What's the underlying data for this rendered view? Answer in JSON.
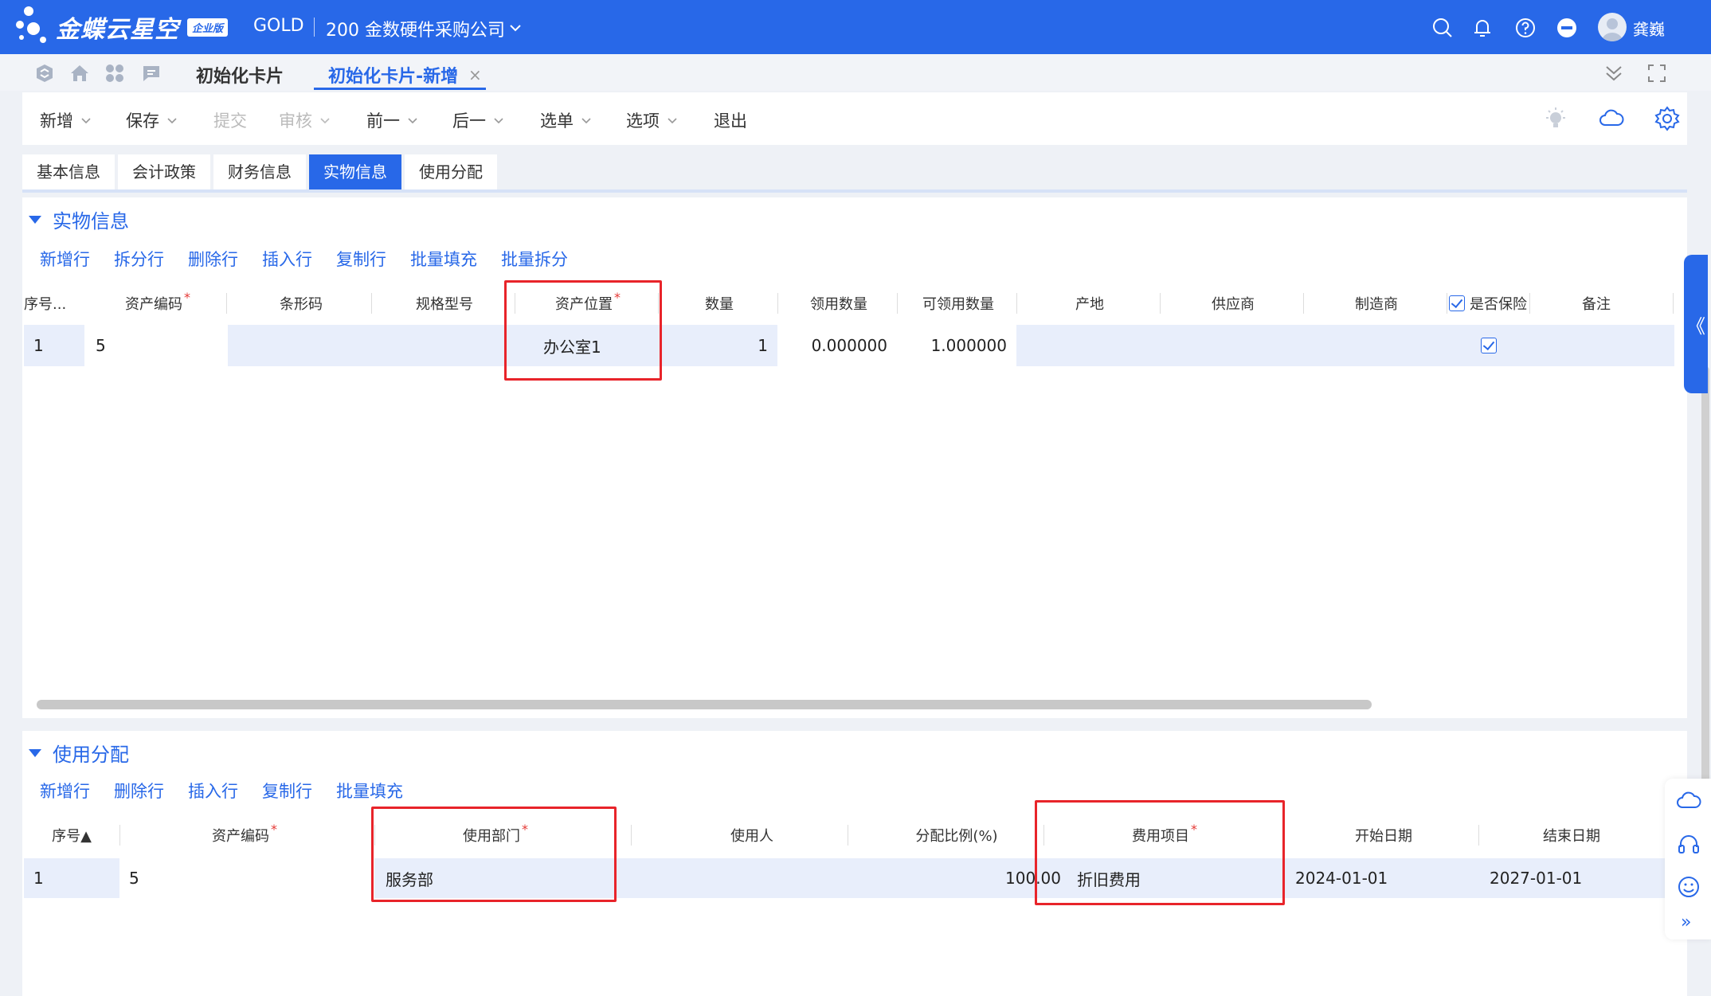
{
  "header": {
    "brand": "金蝶云星空",
    "edition_badge": "企业版",
    "gold": "GOLD",
    "org": "200 金数硬件采购公司",
    "user": "龚巍",
    "brand_color": "#2868e8"
  },
  "page_tabs": [
    {
      "label": "初始化卡片"
    },
    {
      "label": "初始化卡片-新增",
      "close": "×"
    }
  ],
  "toolbar": {
    "buttons": [
      {
        "label": "新增"
      },
      {
        "label": "保存"
      },
      {
        "label": "提交"
      },
      {
        "label": "审核"
      },
      {
        "label": "前一"
      },
      {
        "label": "后一"
      },
      {
        "label": "选单"
      },
      {
        "label": "选项"
      },
      {
        "label": "退出"
      }
    ]
  },
  "section_tabs": [
    "基本信息",
    "会计政策",
    "财务信息",
    "实物信息",
    "使用分配"
  ],
  "physical": {
    "title": "实物信息",
    "actions": [
      "新增行",
      "拆分行",
      "删除行",
      "插入行",
      "复制行",
      "批量填充",
      "批量拆分"
    ],
    "columns": [
      "序号...",
      "资产编码",
      "条形码",
      "规格型号",
      "资产位置",
      "数量",
      "领用数量",
      "可领用数量",
      "产地",
      "供应商",
      "制造商",
      "是否保险",
      "备注"
    ],
    "row": {
      "seq": "1",
      "code": "5",
      "location": "办公室1",
      "qty": "1",
      "used_qty": "0.000000",
      "avail_qty": "1.000000"
    }
  },
  "allocation": {
    "title": "使用分配",
    "actions": [
      "新增行",
      "删除行",
      "插入行",
      "复制行",
      "批量填充"
    ],
    "columns": [
      "序号▲",
      "资产编码",
      "使用部门",
      "使用人",
      "分配比例(%)",
      "费用项目",
      "开始日期",
      "结束日期"
    ],
    "row": {
      "seq": "1",
      "code": "5",
      "dept": "服务部",
      "ratio": "100.00",
      "expense": "折旧费用",
      "start": "2024-01-01",
      "end": "2027-01-01"
    }
  },
  "side": {
    "collapse_glyph": "《",
    "expand_glyph": "»"
  }
}
